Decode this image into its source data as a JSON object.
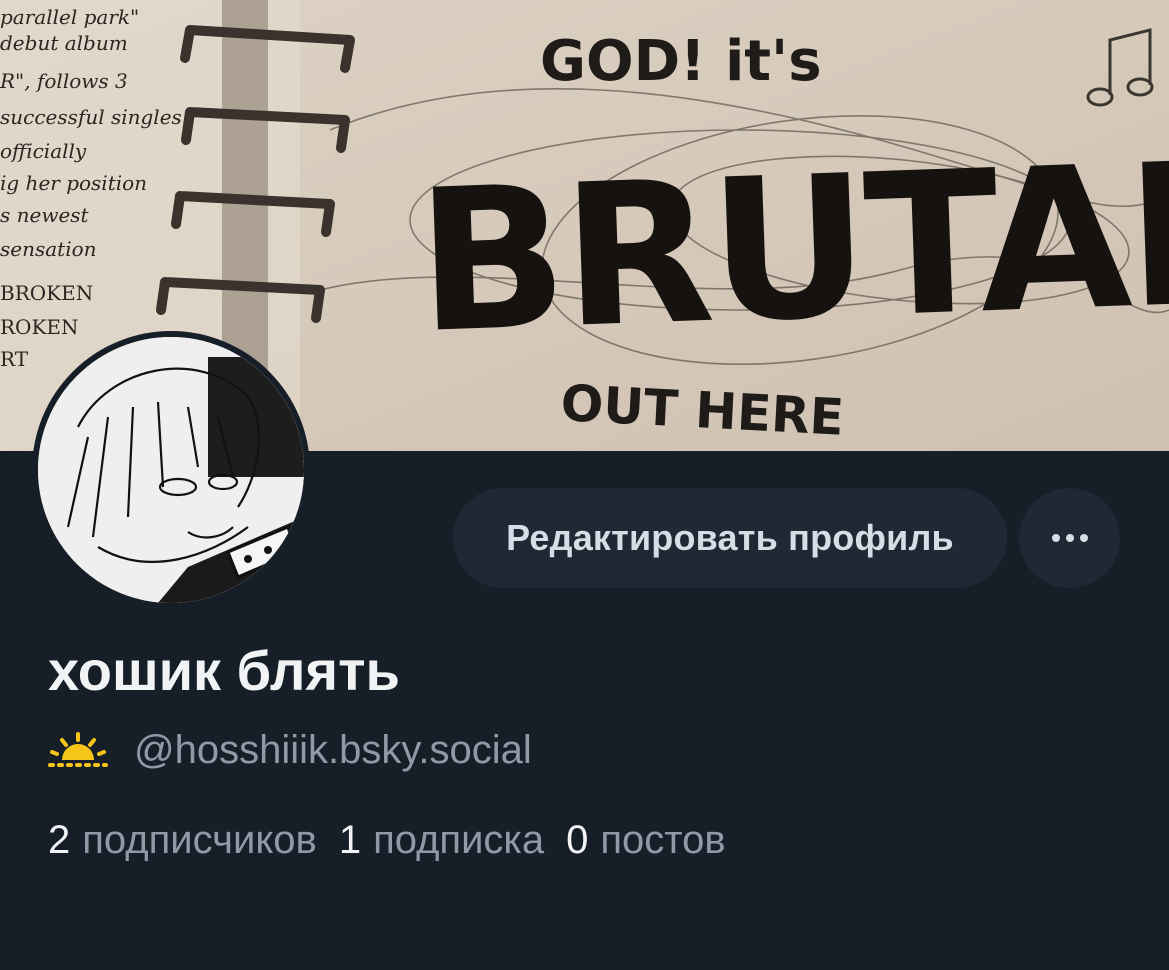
{
  "banner": {
    "text_god": "GOD! it's",
    "text_main": "BRUTAL",
    "text_bottom": "OUT HERE",
    "notes": [
      "parallel park\"",
      "debut album",
      "R\", follows 3",
      "successful singles",
      "officially",
      "ig her position",
      "s newest",
      "sensation",
      "BROKEN",
      "ROKEN",
      "RT"
    ]
  },
  "profile": {
    "edit_label": "Редактировать профиль",
    "more_label": "···",
    "display_name": "хошик блять",
    "handle": "@hosshiiik.bsky.social",
    "stats": [
      {
        "count": "2",
        "label": "подписчиков"
      },
      {
        "count": "1",
        "label": "подписка"
      },
      {
        "count": "0",
        "label": "постов"
      }
    ]
  },
  "colors": {
    "background": "#161e27",
    "button": "#1e2935",
    "muted": "#8e9aa7",
    "sun": "#f5c518"
  }
}
